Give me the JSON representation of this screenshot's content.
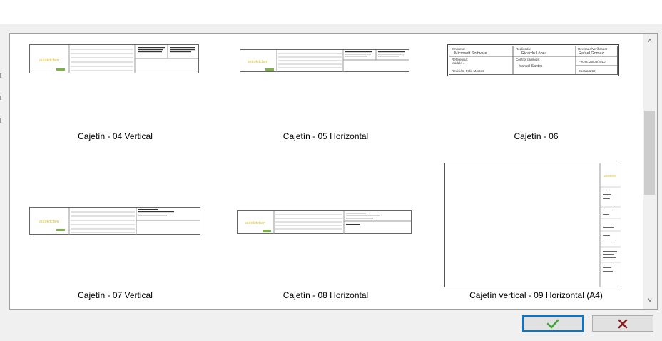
{
  "thumbnails": [
    {
      "caption": "Cajetín - 04 Vertical",
      "logo": "autokitchen"
    },
    {
      "caption": "Cajetín - 05 Horizontal",
      "logo": "autokitchen"
    },
    {
      "caption": "Cajetín - 06",
      "fields": {
        "empresa_label": "Empresa:",
        "empresa_value": "Microsoft Software",
        "realizado_label": "Realizado:",
        "realizado_value": "Ricardo López",
        "revisado_label": "Revisado/Verificador",
        "revisado_value": "Rafael Gomez",
        "referencia_label": "Referencia:",
        "referencia_value": "Modelo 4",
        "control_label": "Control cambios:",
        "control_value": "Manuel Santos",
        "fecha_value": "Fecha: 25/08/2010",
        "revisor_value": "Revisión: Felix Montes",
        "escala_value": "Escala:1:50"
      }
    },
    {
      "caption": "Cajetín - 07 Vertical",
      "logo": "autokitchen"
    },
    {
      "caption": "Cajetín - 08 Horizontal",
      "logo": "autokitchen"
    },
    {
      "caption": "Cajetín vertical - 09 Horizontal (A4)",
      "logo": "autokitchen"
    }
  ],
  "buttons": {
    "ok_icon": "check-icon",
    "cancel_icon": "close-icon"
  },
  "colors": {
    "ok": "#3fa535",
    "cancel": "#8b1d1d",
    "focus": "#0078d7",
    "logo": "#e3c032"
  }
}
